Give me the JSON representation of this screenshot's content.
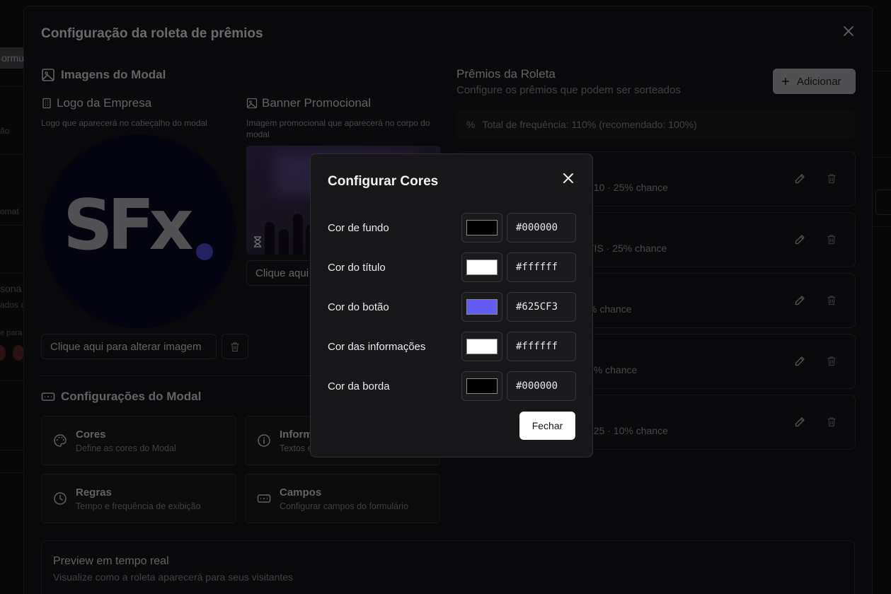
{
  "background": {
    "chip_label": "ormul",
    "fragments": [
      "ão",
      "omat",
      "sona",
      "ados d",
      "e para"
    ]
  },
  "dialog": {
    "title": "Configuração da roleta de prêmios",
    "images_section": "Imagens do Modal",
    "logo": {
      "title": "Logo da Empresa",
      "description": "Logo que aparecerá no cabeçalho do modal",
      "logo_text": "SFx",
      "change_button": "Clique aqui para alterar imagem"
    },
    "banner": {
      "title": "Banner Promocional",
      "description": "Imagem promocional que aparecerá no corpo do modal",
      "change_button": "Clique aqui"
    },
    "config_section": "Configurações do Modal",
    "cards": [
      {
        "title": "Cores",
        "description": "Define as cores do Modal"
      },
      {
        "title": "Inform",
        "description": "Textos e"
      },
      {
        "title": "Regras",
        "description": "Tempo e frequência de exibição"
      },
      {
        "title": "Campos",
        "description": "Configurar campos do formulário"
      }
    ],
    "prizes": {
      "title": "Prêmios da Roleta",
      "subtitle": "Configure os prêmios que podem ser sorteados",
      "add_button": "Adicionar",
      "frequency": "Total de frequência: 110% (recomendado: 100%)",
      "items": [
        {
          "chance": "010 · 25% chance"
        },
        {
          "chance": "TIS · 25% chance"
        },
        {
          "chance": "% chance"
        },
        {
          "chance": "5% chance"
        },
        {
          "chance": "025 · 10% chance"
        }
      ]
    },
    "preview": {
      "title": "Preview em tempo real",
      "description": "Visualize como a roleta aparecerá para seus visitantes"
    }
  },
  "color_modal": {
    "title": "Configurar Cores",
    "rows": [
      {
        "label": "Cor de fundo",
        "value": "#000000",
        "color": "#000000"
      },
      {
        "label": "Cor do título",
        "value": "#ffffff",
        "color": "#ffffff"
      },
      {
        "label": "Cor do botão",
        "value": "#625CF3",
        "color": "#625CF3"
      },
      {
        "label": "Cor das informações",
        "value": "#ffffff",
        "color": "#ffffff"
      },
      {
        "label": "Cor da borda",
        "value": "#000000",
        "color": "#000000"
      }
    ],
    "close_button": "Fechar"
  }
}
